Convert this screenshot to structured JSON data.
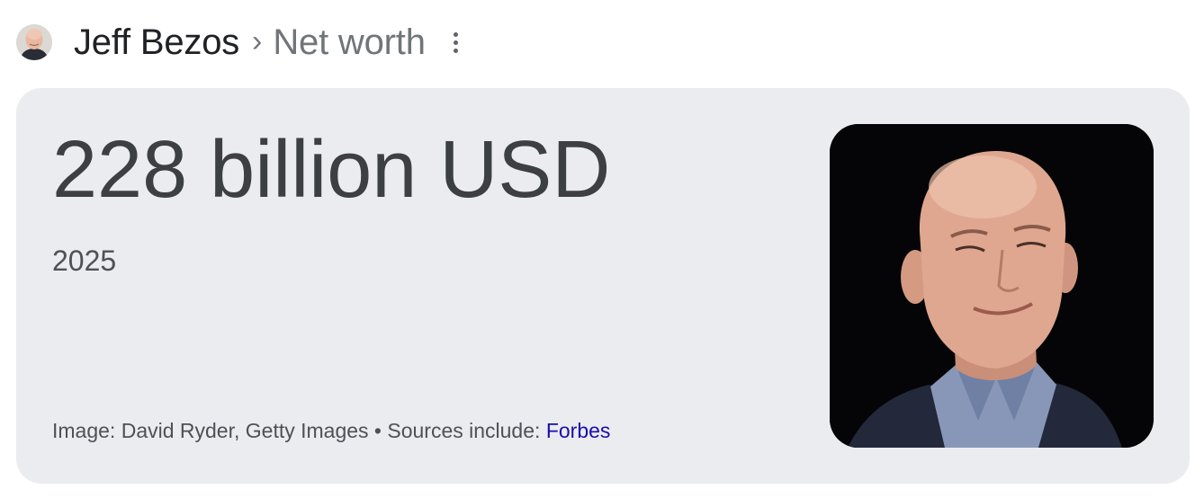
{
  "header": {
    "avatar_icon": "person-thumbnail",
    "entity": "Jeff Bezos",
    "separator": "›",
    "attribute": "Net worth",
    "more_icon": "more-vert-icon"
  },
  "result": {
    "value": "228 billion USD",
    "year": "2025"
  },
  "footer": {
    "image_credit": "Image: David Ryder, Getty Images • Sources include: ",
    "source_link": "Forbes"
  },
  "colors": {
    "card_background": "#ebecef",
    "link": "#1a0dab",
    "value_text": "#3c4043",
    "muted_text": "#70757a"
  }
}
